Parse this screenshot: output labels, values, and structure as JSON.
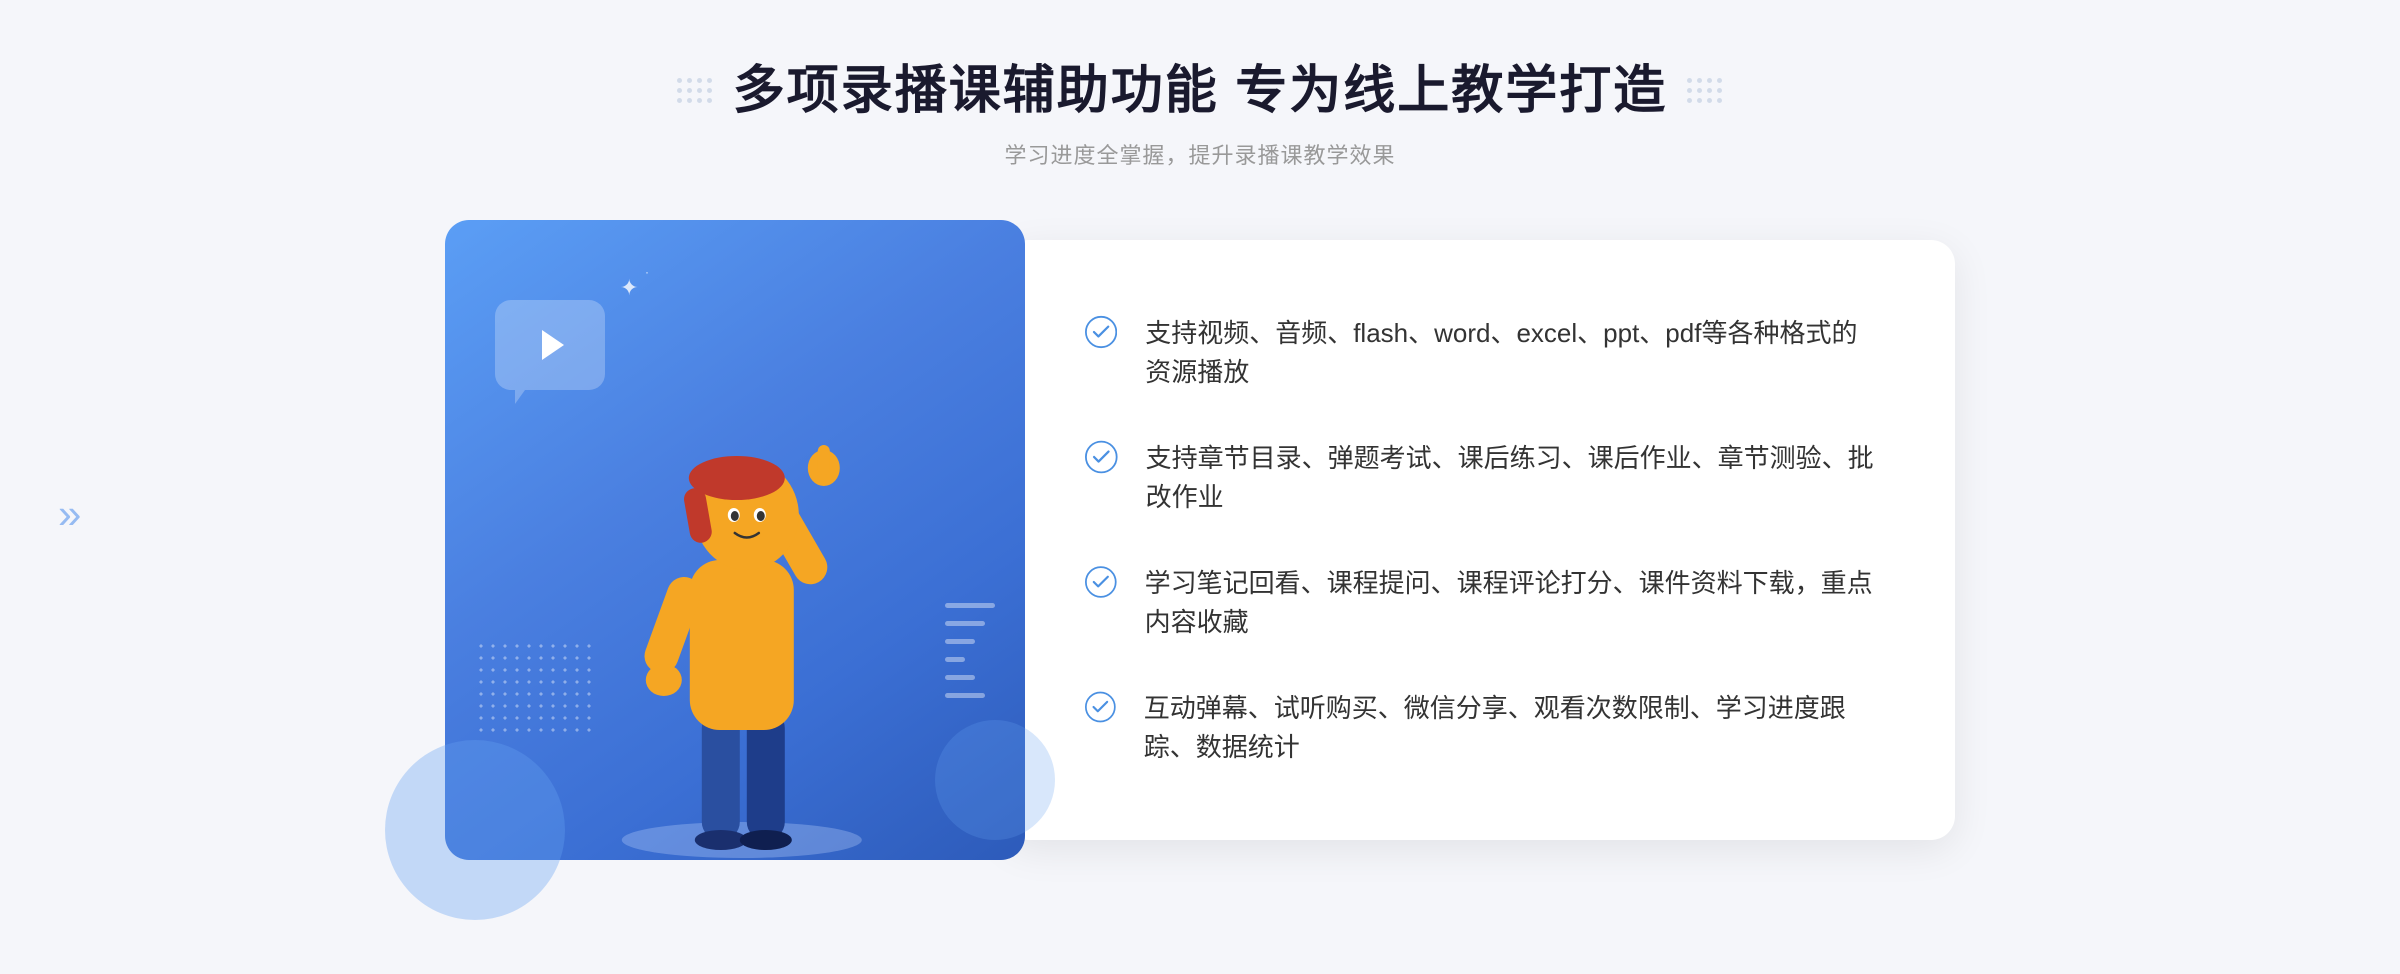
{
  "header": {
    "title": "多项录播课辅助功能 专为线上教学打造",
    "subtitle": "学习进度全掌握，提升录播课教学效果"
  },
  "features": [
    {
      "id": 1,
      "text": "支持视频、音频、flash、word、excel、ppt、pdf等各种格式的资源播放"
    },
    {
      "id": 2,
      "text": "支持章节目录、弹题考试、课后练习、课后作业、章节测验、批改作业"
    },
    {
      "id": 3,
      "text": "学习笔记回看、课程提问、课程评论打分、课件资料下载，重点内容收藏"
    },
    {
      "id": 4,
      "text": "互动弹幕、试听购买、微信分享、观看次数限制、学习进度跟踪、数据统计"
    }
  ],
  "decoration": {
    "chevron_left": "»",
    "chevron_right": "::"
  }
}
